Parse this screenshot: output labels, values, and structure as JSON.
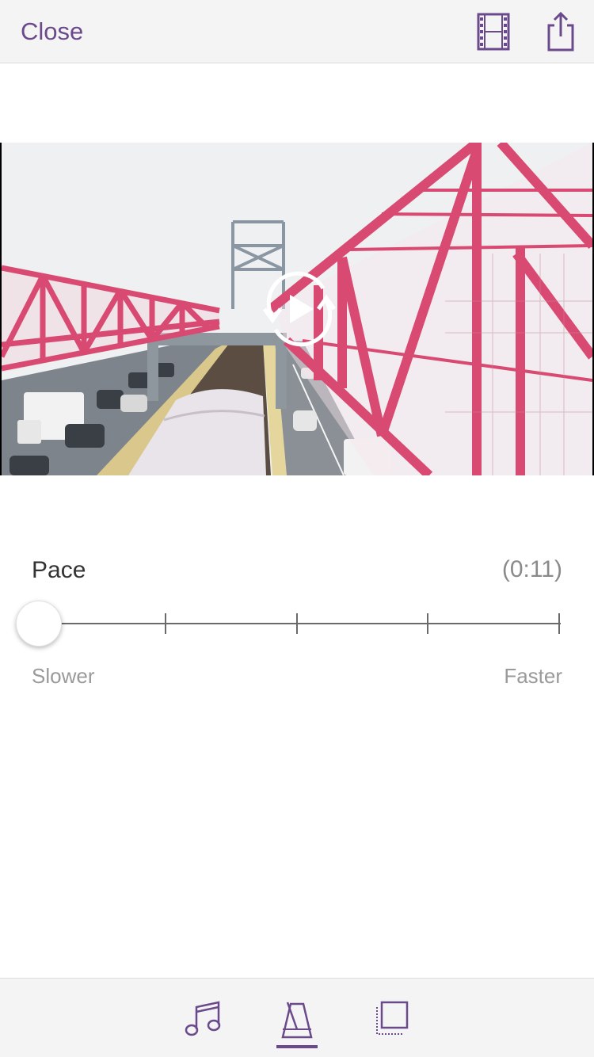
{
  "header": {
    "close_label": "Close",
    "icons": [
      "film-icon",
      "share-icon"
    ]
  },
  "video": {
    "icons": [
      "play-loop-icon"
    ]
  },
  "pace": {
    "label": "Pace",
    "duration": "(0:11)",
    "slower_label": "Slower",
    "faster_label": "Faster",
    "steps": 5,
    "selected_step": 1
  },
  "bottom_tabs": [
    {
      "icon": "music-note-icon",
      "active": false
    },
    {
      "icon": "metronome-icon",
      "active": true
    },
    {
      "icon": "crop-icon",
      "active": false
    }
  ],
  "colors": {
    "accent": "#6b4a8c",
    "bridge": "#d94a72",
    "sky": "#eef0f2"
  }
}
